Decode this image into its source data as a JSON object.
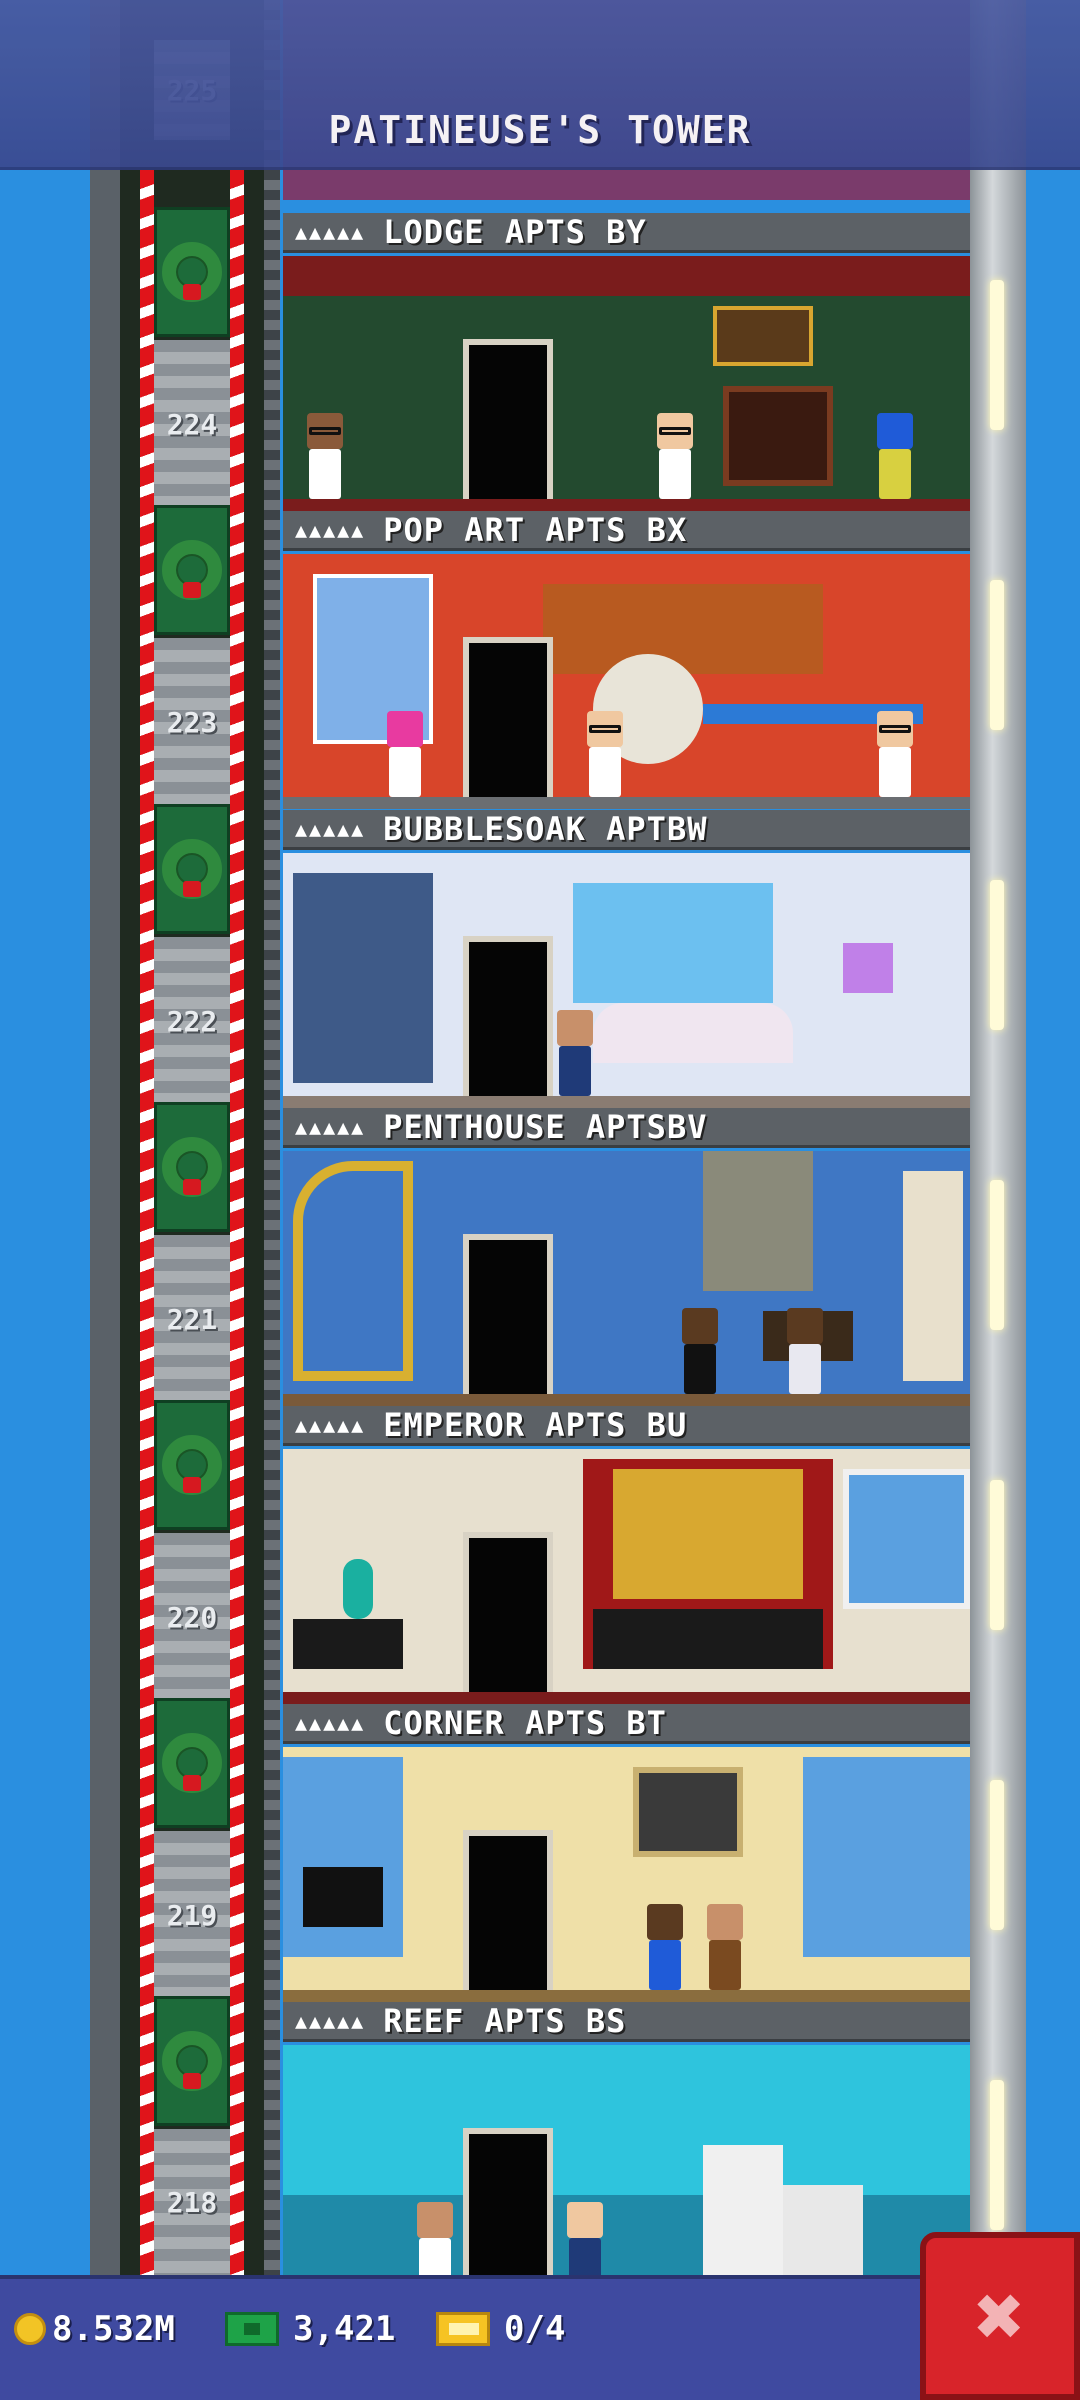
{
  "header": {
    "title": "PATINEUSE'S TOWER"
  },
  "floors": [
    {
      "number": "225",
      "name": "",
      "stars": ""
    },
    {
      "number": "224",
      "name": "LODGE APTS BY",
      "stars": "▲▲▲▲▲",
      "wall": "#234a2f",
      "floor": "#7a1c1c"
    },
    {
      "number": "223",
      "name": "POP ART APTS BX",
      "stars": "▲▲▲▲▲",
      "wall": "#d8452a",
      "floor": "#6b6e72"
    },
    {
      "number": "222",
      "name": "BUBBLESOAK APTBW",
      "stars": "▲▲▲▲▲",
      "wall": "#dfe6f4",
      "floor": "#8a7c72"
    },
    {
      "number": "221",
      "name": "PENTHOUSE APTSBV",
      "stars": "▲▲▲▲▲",
      "wall": "#3f77c4",
      "floor": "#7a5a3a"
    },
    {
      "number": "220",
      "name": "EMPEROR APTS BU",
      "stars": "▲▲▲▲▲",
      "wall": "#e7e0cf",
      "floor": "#7a1c1c"
    },
    {
      "number": "219",
      "name": "CORNER APTS BT",
      "stars": "▲▲▲▲▲",
      "wall": "#efe0a8",
      "floor": "#8a6d3e"
    },
    {
      "number": "218",
      "name": "REEF APTS BS",
      "stars": "▲▲▲▲▲",
      "wall": "#2ec4dd",
      "floor": "#1f6f88"
    }
  ],
  "resources": {
    "coins": "8.532M",
    "bux": "3,421",
    "tickets": "0/4"
  },
  "icons": {
    "coin": "coin-icon",
    "bux": "bux-icon",
    "ticket": "ticket-icon",
    "close": "close-icon",
    "wreath": "wreath-icon"
  },
  "close_label": "✖"
}
